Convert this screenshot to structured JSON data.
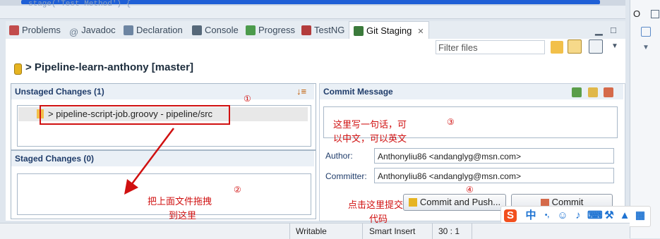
{
  "editor": {
    "code": "stage('Test Method') {"
  },
  "outline": {
    "label": "O"
  },
  "tabs": [
    {
      "label": "Problems",
      "icon": "problems-icon",
      "color": "#c24c4c"
    },
    {
      "label": "Javadoc",
      "icon": "at-icon",
      "color": "#6e7f93"
    },
    {
      "label": "Declaration",
      "icon": "declaration-icon",
      "color": "#6d85a2"
    },
    {
      "label": "Console",
      "icon": "console-icon",
      "color": "#566879"
    },
    {
      "label": "Progress",
      "icon": "progress-icon",
      "color": "#4c9b4c"
    },
    {
      "label": "TestNG",
      "icon": "testng-icon",
      "color": "#b33c3c"
    },
    {
      "label": "Git Staging",
      "icon": "git-staging-icon",
      "color": "#3b7a3b"
    }
  ],
  "staging": {
    "filter_placeholder": "Filter files",
    "repo_title": "> Pipeline-learn-anthony [master]",
    "unstaged_title": "Unstaged Changes (1)",
    "unstaged_file": "> pipeline-script-job.groovy - pipeline/src",
    "staged_title": "Staged Changes (0)",
    "commit_title": "Commit Message",
    "commit_message": "",
    "author_label": "Author:",
    "author_value": "Anthonyliu86 <andanglyg@msn.com>",
    "committer_label": "Committer:",
    "committer_value": "Anthonyliu86 <andanglyg@msn.com>",
    "commit_push_label": "Commit and Push...",
    "commit_label": "Commit"
  },
  "annotations": {
    "n1": "①",
    "n2": "②",
    "n3": "③",
    "n4": "④",
    "drag_line1": "把上面文件拖拽",
    "drag_line2": "到这里",
    "msg_line1": "这里写一句话，可",
    "msg_line2": "以中文，可以英文",
    "click_line1": "点击这里提交",
    "click_line2": "代码"
  },
  "status": {
    "writable": "Writable",
    "insert_mode": "Smart Insert",
    "position": "30 : 1"
  },
  "ime": {
    "input_mode": "中"
  },
  "colors": {
    "annotation": "#d01010",
    "accent": "#1f5fd6"
  }
}
